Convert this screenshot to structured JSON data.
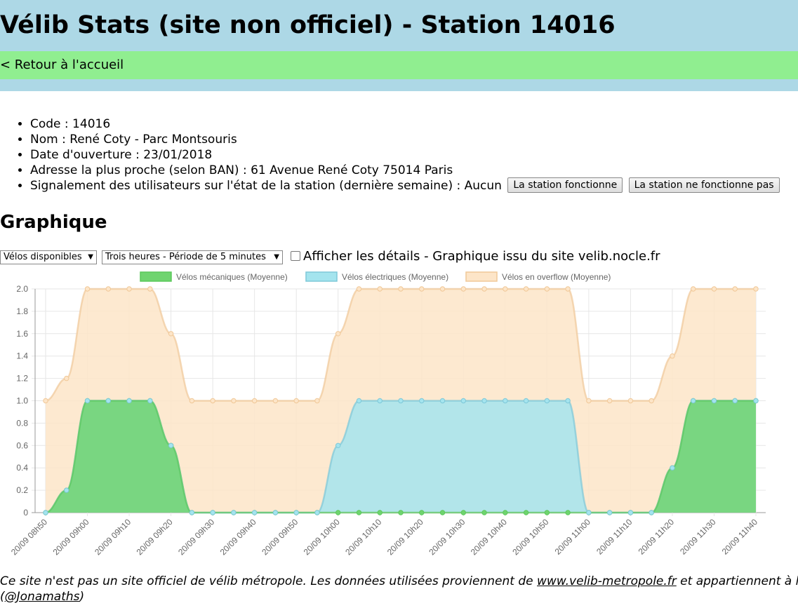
{
  "header": {
    "title": "Vélib Stats (site non officiel) - Station 14016",
    "back_link": "< Retour à l'accueil"
  },
  "station": {
    "items": [
      "Code : 14016",
      "Nom : René Coty - Parc Montsouris",
      "Date d'ouverture : 23/01/2018",
      "Adresse la plus proche (selon BAN) : 61 Avenue René Coty 75014 Paris"
    ],
    "report_label": "Signalement des utilisateurs sur l'état de la station (dernière semaine) : Aucun",
    "btn_works": "La station fonctionne",
    "btn_not_works": "La station ne fonctionne pas"
  },
  "graph_section": {
    "heading": "Graphique",
    "metric_select": "Vélos disponibles",
    "period_select": "Trois heures - Période de 5 minutes",
    "details_label": "Afficher les détails - Graphique issu du site velib.nocle.fr"
  },
  "chart_data": {
    "type": "area",
    "stacked": true,
    "legend_position": "top",
    "grid": true,
    "ylim": [
      0,
      2.0
    ],
    "yticks": [
      "0",
      "0.2",
      "0.4",
      "0.6",
      "0.8",
      "1.0",
      "1.2",
      "1.4",
      "1.6",
      "1.8",
      "2.0"
    ],
    "x": [
      "20/09 08h50",
      "20/09 08h55",
      "20/09 09h00",
      "20/09 09h05",
      "20/09 09h10",
      "20/09 09h15",
      "20/09 09h20",
      "20/09 09h25",
      "20/09 09h30",
      "20/09 09h35",
      "20/09 09h40",
      "20/09 09h45",
      "20/09 09h50",
      "20/09 09h55",
      "20/09 10h00",
      "20/09 10h05",
      "20/09 10h10",
      "20/09 10h15",
      "20/09 10h20",
      "20/09 10h25",
      "20/09 10h30",
      "20/09 10h35",
      "20/09 10h40",
      "20/09 10h45",
      "20/09 10h50",
      "20/09 10h55",
      "20/09 11h00",
      "20/09 11h05",
      "20/09 11h10",
      "20/09 11h15",
      "20/09 11h20",
      "20/09 11h25",
      "20/09 11h30",
      "20/09 11h35",
      "20/09 11h40"
    ],
    "xtick_labels": [
      "20/09 08h50",
      "20/09 09h00",
      "20/09 09h10",
      "20/09 09h20",
      "20/09 09h30",
      "20/09 09h40",
      "20/09 09h50",
      "20/09 10h00",
      "20/09 10h10",
      "20/09 10h20",
      "20/09 10h30",
      "20/09 10h40",
      "20/09 10h50",
      "20/09 11h00",
      "20/09 11h10",
      "20/09 11h20",
      "20/09 11h30",
      "20/09 11h40"
    ],
    "series": [
      {
        "name": "Vélos mécaniques (Moyenne)",
        "color": "#5cc85c",
        "fill": "#6fd46f",
        "values": [
          0,
          0.2,
          1,
          1,
          1,
          1,
          0.6,
          0,
          0,
          0,
          0,
          0,
          0,
          0,
          0,
          0,
          0,
          0,
          0,
          0,
          0,
          0,
          0,
          0,
          0,
          0,
          0,
          0,
          0,
          0,
          0.4,
          1,
          1,
          1,
          1
        ]
      },
      {
        "name": "Vélos électriques (Moyenne)",
        "color": "#7ec8d8",
        "fill": "#a4e4ee",
        "values": [
          0,
          0,
          0,
          0,
          0,
          0,
          0,
          0,
          0,
          0,
          0,
          0,
          0,
          0,
          0.6,
          1,
          1,
          1,
          1,
          1,
          1,
          1,
          1,
          1,
          1,
          1,
          0,
          0,
          0,
          0,
          0,
          0,
          0,
          0,
          0
        ]
      },
      {
        "name": "Vélos en overflow (Moyenne)",
        "color": "#f0c898",
        "fill": "#fde5c8",
        "values": [
          1,
          1,
          1,
          1,
          1,
          1,
          1,
          1,
          1,
          1,
          1,
          1,
          1,
          1,
          1,
          1,
          1,
          1,
          1,
          1,
          1,
          1,
          1,
          1,
          1,
          1,
          1,
          1,
          1,
          1,
          1,
          1,
          1,
          1,
          1
        ]
      }
    ]
  },
  "footer": {
    "text_before": "Ce site n'est pas un site officiel de vélib métropole. Les données utilisées proviennent de ",
    "link": "www.velib-metropole.fr",
    "text_after": " et appartiennent à leurs propriétaires.",
    "author_open": "(",
    "author": "@Jonamaths",
    "author_close": ")"
  }
}
